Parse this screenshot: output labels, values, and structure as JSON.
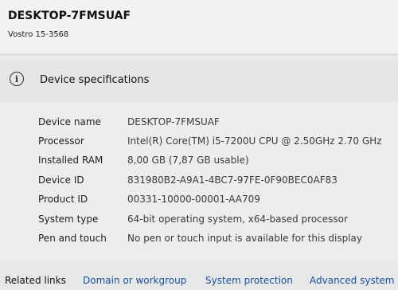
{
  "device": {
    "title": "DESKTOP-7FMSUAF",
    "model": "Vostro 15-3568"
  },
  "specifications": {
    "section_title": "Device specifications",
    "icon": "info-icon",
    "rows": [
      {
        "label": "Device name",
        "value": "DESKTOP-7FMSUAF"
      },
      {
        "label": "Processor",
        "value": "Intel(R) Core(TM) i5-7200U CPU @ 2.50GHz   2.70 GHz"
      },
      {
        "label": "Installed RAM",
        "value": "8,00 GB (7,87 GB usable)"
      },
      {
        "label": "Device ID",
        "value": "831980B2-A9A1-4BC7-97FE-0F90BEC0AF83"
      },
      {
        "label": "Product ID",
        "value": "00331-10000-00001-AA709"
      },
      {
        "label": "System type",
        "value": "64-bit operating system, x64-based processor"
      },
      {
        "label": "Pen and touch",
        "value": "No pen or touch input is available for this display"
      }
    ]
  },
  "footer": {
    "related_label": "Related links",
    "links": [
      "Domain or workgroup",
      "System protection",
      "Advanced system"
    ]
  },
  "colors": {
    "link": "#1a4f9c",
    "background": "#e9eaea"
  }
}
